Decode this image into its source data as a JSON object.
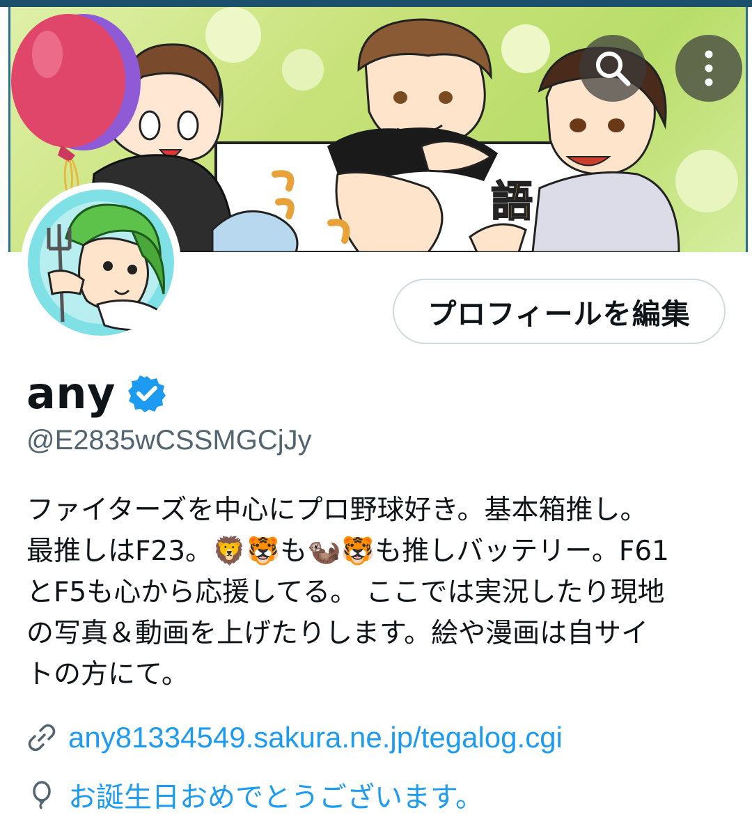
{
  "header": {
    "search_icon": "search-icon",
    "more_icon": "more-vertical-icon"
  },
  "profile": {
    "edit_button_label": "プロフィールを編集",
    "display_name": "any",
    "verified": true,
    "handle": "@E2835wCSSMGCjJy",
    "bio": "ファイターズを中心にプロ野球好き。基本箱推し。\n最推しはF23。🦁🐯も🦦🐯も推しバッテリー。F61\nとF5も心から応援してる。 ここでは実況したり現地\nの写真＆動画を上げたりします。絵や漫画は自サイ\nトの方にて。",
    "website": "any81334549.sakura.ne.jp/tegalog.cgi",
    "birthday_text": "お誕生日おめでとうございます。"
  },
  "colors": {
    "accent": "#1d9bf0",
    "secondary_text": "#536471",
    "border": "#cfd9de"
  }
}
